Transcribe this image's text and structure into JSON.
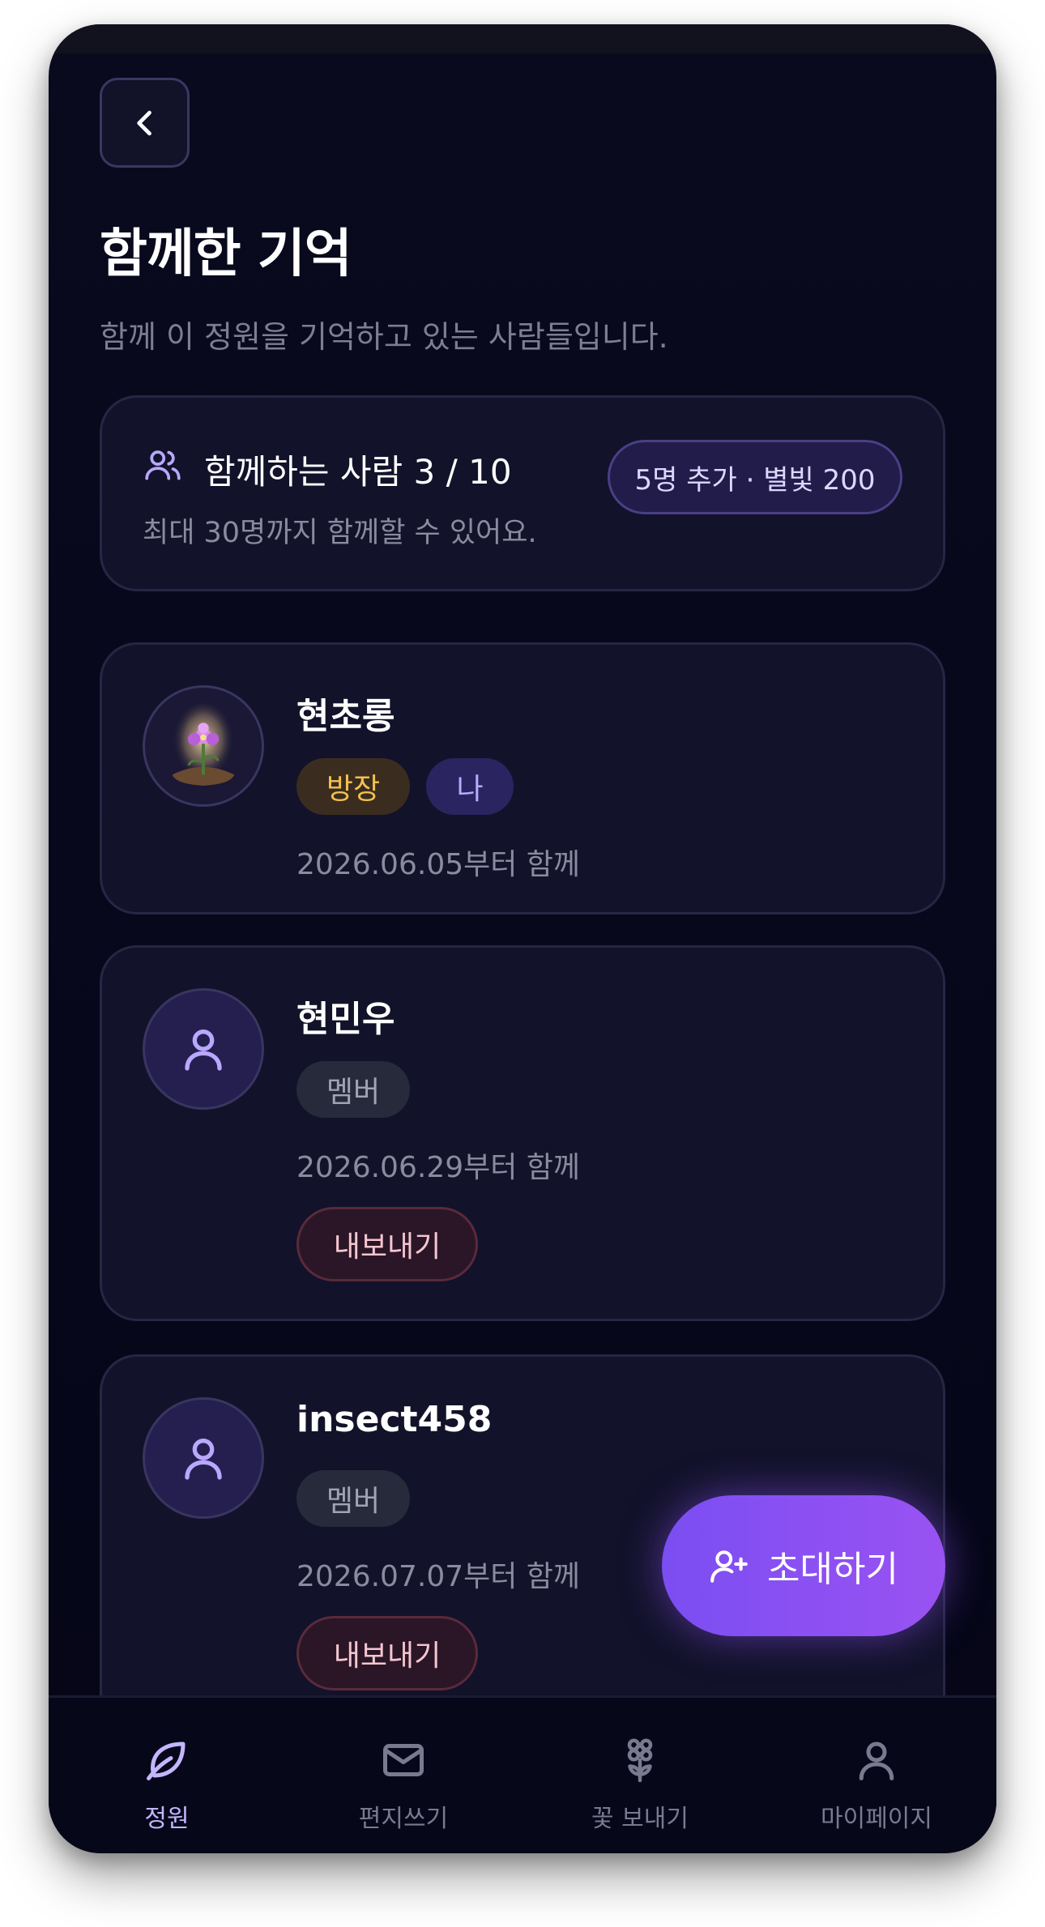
{
  "header": {
    "back_icon": "chevron-left-icon",
    "title": "함께한 기억",
    "subtitle": "함께 이 정원을 기억하고 있는 사람들입니다."
  },
  "summary": {
    "icon": "people-icon",
    "count_label": "함께하는 사람 3 / 10",
    "limit_text": "최대 30명까지 함께할 수 있어요.",
    "add_button": "5명 추가 · 별빛 200"
  },
  "members": [
    {
      "name": "현초롱",
      "avatar": "flower-image",
      "badges": [
        "방장",
        "나"
      ],
      "since": "2026.06.05부터 함께"
    },
    {
      "name": "현민우",
      "avatar": "user-icon",
      "badges": [
        "멤버"
      ],
      "since": "2026.06.29부터 함께",
      "kick_label": "내보내기"
    },
    {
      "name": "insect458",
      "avatar": "user-icon",
      "badges": [
        "멤버"
      ],
      "since": "2026.07.07부터 함께",
      "kick_label": "내보내기"
    }
  ],
  "fab": {
    "icon": "user-plus-icon",
    "label": "초대하기"
  },
  "tabbar": {
    "active": "정원",
    "tabs": [
      {
        "label": "정원",
        "icon": "leaf-icon"
      },
      {
        "label": "편지쓰기",
        "icon": "mail-icon"
      },
      {
        "label": "꽃 보내기",
        "icon": "flower-icon"
      },
      {
        "label": "마이페이지",
        "icon": "user-icon"
      }
    ]
  },
  "colors": {
    "background": "#07071c",
    "card": "#12122a",
    "accent": "#8b50f2",
    "owner_badge_text": "#f2c04e",
    "kick_text": "#f5c6d0"
  }
}
